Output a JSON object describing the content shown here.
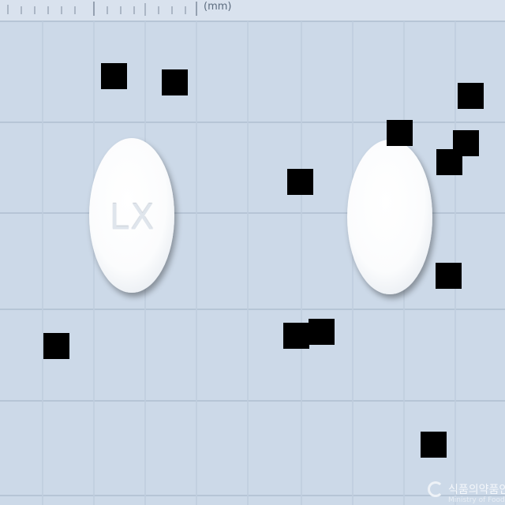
{
  "scale": {
    "unit_label": "(mm)"
  },
  "tablets": [
    {
      "name": "front",
      "imprint": "LX",
      "color": "#ffffff"
    },
    {
      "name": "back",
      "imprint": "",
      "color": "#ffffff"
    }
  ],
  "watermark": {
    "text": "식품의약품안전처",
    "subtext": "Ministry of Food and Drug Safety"
  },
  "colors": {
    "background": "#ccd9e8",
    "grid": "#b8c7d8",
    "redaction": "#000000"
  }
}
